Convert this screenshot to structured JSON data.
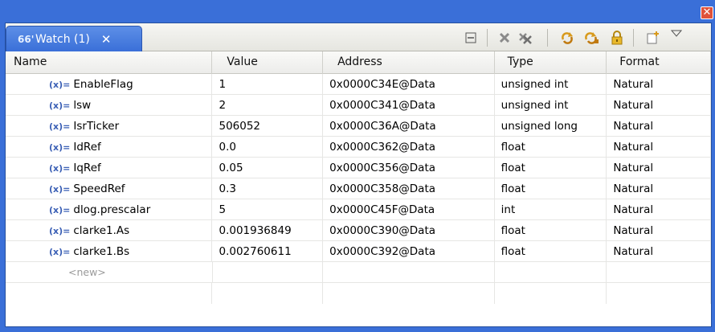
{
  "view": {
    "tab_title": "Watch (1)",
    "tab_icon": "66'",
    "tab_close": "✕",
    "window_close": "✕"
  },
  "toolbar": {
    "icons": [
      "minimize-icon",
      "remove-icon",
      "remove-all-icon",
      "refresh-icon",
      "continuous-refresh-icon",
      "lock-icon",
      "new-expression-icon",
      "view-menu-icon"
    ]
  },
  "table": {
    "columns": [
      "Name",
      "Value",
      "Address",
      "Type",
      "Format"
    ],
    "var_icon": "(x)=",
    "rows": [
      {
        "name": "EnableFlag",
        "value": "1",
        "address": "0x0000C34E@Data",
        "type": "unsigned int",
        "format": "Natural"
      },
      {
        "name": "lsw",
        "value": "2",
        "address": "0x0000C341@Data",
        "type": "unsigned int",
        "format": "Natural"
      },
      {
        "name": "IsrTicker",
        "value": "506052",
        "address": "0x0000C36A@Data",
        "type": "unsigned long",
        "format": "Natural"
      },
      {
        "name": "IdRef",
        "value": "0.0",
        "address": "0x0000C362@Data",
        "type": "float",
        "format": "Natural"
      },
      {
        "name": "IqRef",
        "value": "0.05",
        "address": "0x0000C356@Data",
        "type": "float",
        "format": "Natural"
      },
      {
        "name": "SpeedRef",
        "value": "0.3",
        "address": "0x0000C358@Data",
        "type": "float",
        "format": "Natural"
      },
      {
        "name": "dlog.prescalar",
        "value": "5",
        "address": "0x0000C45F@Data",
        "type": "int",
        "format": "Natural"
      },
      {
        "name": "clarke1.As",
        "value": "0.001936849",
        "address": "0x0000C390@Data",
        "type": "float",
        "format": "Natural"
      },
      {
        "name": "clarke1.Bs",
        "value": "0.002760611",
        "address": "0x0000C392@Data",
        "type": "float",
        "format": "Natural"
      }
    ],
    "new_entry": "<new>"
  }
}
